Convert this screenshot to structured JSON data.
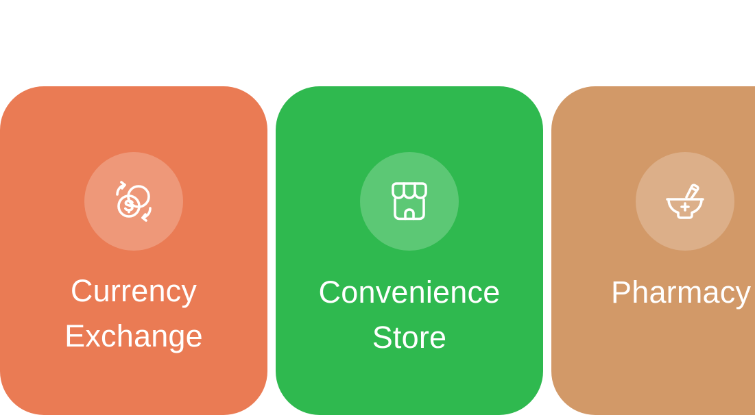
{
  "cards": [
    {
      "id": "currency-exchange",
      "label_line1": "Currency",
      "label_line2": "Exchange",
      "color": "#EA7B54",
      "icon": "currency-exchange-icon"
    },
    {
      "id": "convenience-store",
      "label_line1": "Convenience",
      "label_line2": "Store",
      "color": "#2FB94F",
      "icon": "storefront-icon"
    },
    {
      "id": "pharmacy",
      "label_line1": "Pharmacy",
      "label_line2": "",
      "color": "#D29968",
      "icon": "mortar-pestle-icon"
    }
  ]
}
